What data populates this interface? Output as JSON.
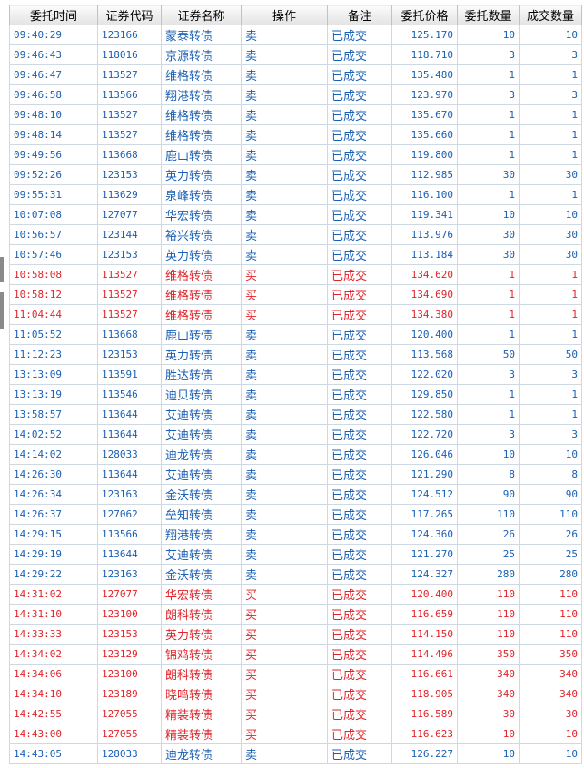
{
  "table": {
    "headers": [
      "委托时间",
      "证券代码",
      "证券名称",
      "操作",
      "备注",
      "委托价格",
      "委托数量",
      "成交数量"
    ],
    "rows": [
      {
        "time": "09:40:29",
        "code": "123166",
        "name": "蒙泰转债",
        "op": "卖",
        "note": "已成交",
        "price": "125.170",
        "qty": "10",
        "filled": "10",
        "side": "sell"
      },
      {
        "time": "09:46:43",
        "code": "118016",
        "name": "京源转债",
        "op": "卖",
        "note": "已成交",
        "price": "118.710",
        "qty": "3",
        "filled": "3",
        "side": "sell"
      },
      {
        "time": "09:46:47",
        "code": "113527",
        "name": "维格转债",
        "op": "卖",
        "note": "已成交",
        "price": "135.480",
        "qty": "1",
        "filled": "1",
        "side": "sell"
      },
      {
        "time": "09:46:58",
        "code": "113566",
        "name": "翔港转债",
        "op": "卖",
        "note": "已成交",
        "price": "123.970",
        "qty": "3",
        "filled": "3",
        "side": "sell"
      },
      {
        "time": "09:48:10",
        "code": "113527",
        "name": "维格转债",
        "op": "卖",
        "note": "已成交",
        "price": "135.670",
        "qty": "1",
        "filled": "1",
        "side": "sell"
      },
      {
        "time": "09:48:14",
        "code": "113527",
        "name": "维格转债",
        "op": "卖",
        "note": "已成交",
        "price": "135.660",
        "qty": "1",
        "filled": "1",
        "side": "sell"
      },
      {
        "time": "09:49:56",
        "code": "113668",
        "name": "鹿山转债",
        "op": "卖",
        "note": "已成交",
        "price": "119.800",
        "qty": "1",
        "filled": "1",
        "side": "sell"
      },
      {
        "time": "09:52:26",
        "code": "123153",
        "name": "英力转债",
        "op": "卖",
        "note": "已成交",
        "price": "112.985",
        "qty": "30",
        "filled": "30",
        "side": "sell"
      },
      {
        "time": "09:55:31",
        "code": "113629",
        "name": "泉峰转债",
        "op": "卖",
        "note": "已成交",
        "price": "116.100",
        "qty": "1",
        "filled": "1",
        "side": "sell"
      },
      {
        "time": "10:07:08",
        "code": "127077",
        "name": "华宏转债",
        "op": "卖",
        "note": "已成交",
        "price": "119.341",
        "qty": "10",
        "filled": "10",
        "side": "sell"
      },
      {
        "time": "10:56:57",
        "code": "123144",
        "name": "裕兴转债",
        "op": "卖",
        "note": "已成交",
        "price": "113.976",
        "qty": "30",
        "filled": "30",
        "side": "sell"
      },
      {
        "time": "10:57:46",
        "code": "123153",
        "name": "英力转债",
        "op": "卖",
        "note": "已成交",
        "price": "113.184",
        "qty": "30",
        "filled": "30",
        "side": "sell"
      },
      {
        "time": "10:58:08",
        "code": "113527",
        "name": "维格转债",
        "op": "买",
        "note": "已成交",
        "price": "134.620",
        "qty": "1",
        "filled": "1",
        "side": "buy"
      },
      {
        "time": "10:58:12",
        "code": "113527",
        "name": "维格转债",
        "op": "买",
        "note": "已成交",
        "price": "134.690",
        "qty": "1",
        "filled": "1",
        "side": "buy"
      },
      {
        "time": "11:04:44",
        "code": "113527",
        "name": "维格转债",
        "op": "买",
        "note": "已成交",
        "price": "134.380",
        "qty": "1",
        "filled": "1",
        "side": "buy"
      },
      {
        "time": "11:05:52",
        "code": "113668",
        "name": "鹿山转债",
        "op": "卖",
        "note": "已成交",
        "price": "120.400",
        "qty": "1",
        "filled": "1",
        "side": "sell"
      },
      {
        "time": "11:12:23",
        "code": "123153",
        "name": "英力转债",
        "op": "卖",
        "note": "已成交",
        "price": "113.568",
        "qty": "50",
        "filled": "50",
        "side": "sell"
      },
      {
        "time": "13:13:09",
        "code": "113591",
        "name": "胜达转债",
        "op": "卖",
        "note": "已成交",
        "price": "122.020",
        "qty": "3",
        "filled": "3",
        "side": "sell"
      },
      {
        "time": "13:13:19",
        "code": "113546",
        "name": "迪贝转债",
        "op": "卖",
        "note": "已成交",
        "price": "129.850",
        "qty": "1",
        "filled": "1",
        "side": "sell"
      },
      {
        "time": "13:58:57",
        "code": "113644",
        "name": "艾迪转债",
        "op": "卖",
        "note": "已成交",
        "price": "122.580",
        "qty": "1",
        "filled": "1",
        "side": "sell"
      },
      {
        "time": "14:02:52",
        "code": "113644",
        "name": "艾迪转债",
        "op": "卖",
        "note": "已成交",
        "price": "122.720",
        "qty": "3",
        "filled": "3",
        "side": "sell"
      },
      {
        "time": "14:14:02",
        "code": "128033",
        "name": "迪龙转债",
        "op": "卖",
        "note": "已成交",
        "price": "126.046",
        "qty": "10",
        "filled": "10",
        "side": "sell"
      },
      {
        "time": "14:26:30",
        "code": "113644",
        "name": "艾迪转债",
        "op": "卖",
        "note": "已成交",
        "price": "121.290",
        "qty": "8",
        "filled": "8",
        "side": "sell"
      },
      {
        "time": "14:26:34",
        "code": "123163",
        "name": "金沃转债",
        "op": "卖",
        "note": "已成交",
        "price": "124.512",
        "qty": "90",
        "filled": "90",
        "side": "sell"
      },
      {
        "time": "14:26:37",
        "code": "127062",
        "name": "垒知转债",
        "op": "卖",
        "note": "已成交",
        "price": "117.265",
        "qty": "110",
        "filled": "110",
        "side": "sell"
      },
      {
        "time": "14:29:15",
        "code": "113566",
        "name": "翔港转债",
        "op": "卖",
        "note": "已成交",
        "price": "124.360",
        "qty": "26",
        "filled": "26",
        "side": "sell"
      },
      {
        "time": "14:29:19",
        "code": "113644",
        "name": "艾迪转债",
        "op": "卖",
        "note": "已成交",
        "price": "121.270",
        "qty": "25",
        "filled": "25",
        "side": "sell"
      },
      {
        "time": "14:29:22",
        "code": "123163",
        "name": "金沃转债",
        "op": "卖",
        "note": "已成交",
        "price": "124.327",
        "qty": "280",
        "filled": "280",
        "side": "sell"
      },
      {
        "time": "14:31:02",
        "code": "127077",
        "name": "华宏转债",
        "op": "买",
        "note": "已成交",
        "price": "120.400",
        "qty": "110",
        "filled": "110",
        "side": "buy"
      },
      {
        "time": "14:31:10",
        "code": "123100",
        "name": "朗科转债",
        "op": "买",
        "note": "已成交",
        "price": "116.659",
        "qty": "110",
        "filled": "110",
        "side": "buy"
      },
      {
        "time": "14:33:33",
        "code": "123153",
        "name": "英力转债",
        "op": "买",
        "note": "已成交",
        "price": "114.150",
        "qty": "110",
        "filled": "110",
        "side": "buy"
      },
      {
        "time": "14:34:02",
        "code": "123129",
        "name": "锦鸡转债",
        "op": "买",
        "note": "已成交",
        "price": "114.496",
        "qty": "350",
        "filled": "350",
        "side": "buy"
      },
      {
        "time": "14:34:06",
        "code": "123100",
        "name": "朗科转债",
        "op": "买",
        "note": "已成交",
        "price": "116.661",
        "qty": "340",
        "filled": "340",
        "side": "buy"
      },
      {
        "time": "14:34:10",
        "code": "123189",
        "name": "晓鸣转债",
        "op": "买",
        "note": "已成交",
        "price": "118.905",
        "qty": "340",
        "filled": "340",
        "side": "buy"
      },
      {
        "time": "14:42:55",
        "code": "127055",
        "name": "精装转债",
        "op": "买",
        "note": "已成交",
        "price": "116.589",
        "qty": "30",
        "filled": "30",
        "side": "buy"
      },
      {
        "time": "14:43:00",
        "code": "127055",
        "name": "精装转债",
        "op": "买",
        "note": "已成交",
        "price": "116.623",
        "qty": "10",
        "filled": "10",
        "side": "buy"
      },
      {
        "time": "14:43:05",
        "code": "128033",
        "name": "迪龙转债",
        "op": "卖",
        "note": "已成交",
        "price": "126.227",
        "qty": "10",
        "filled": "10",
        "side": "sell"
      }
    ]
  },
  "colors": {
    "sell": "#1a5fb4",
    "buy": "#e0242a",
    "grid": "#cfd9e3",
    "header_bg": "#e8e8e8"
  }
}
